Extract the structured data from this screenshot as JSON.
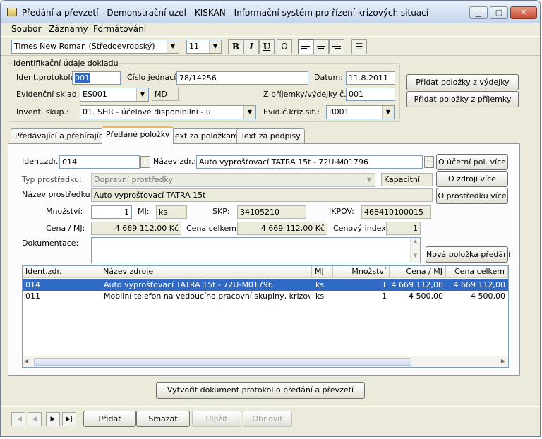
{
  "window": {
    "title": "Předání a převzetí - Demonstrační uzel - KISKAN - Informační systém pro řízení krizových situací",
    "min": "▁",
    "max": "▢",
    "close": "✕"
  },
  "menu": [
    "Soubor",
    "Záznamy",
    "Formátování"
  ],
  "toolbar": {
    "font": "Times New Roman (Středoevropský)",
    "size": "11",
    "bold": "B",
    "italic": "I",
    "underline": "U",
    "special": "Ω",
    "list": "☰"
  },
  "header": {
    "group_title": "Identifikační údaje dokladu",
    "ident_label": "Ident.protokolu:",
    "ident_value": "001",
    "cislo_label": "Číslo jednací:",
    "cislo_value": "78/14256",
    "datum_label": "Datum:",
    "datum_value": "11.8.2011",
    "sklad_label": "Evidenční sklad:",
    "sklad_value": "ES001",
    "sklad_extra": "MD",
    "zprijemky_label": "Z příjemky/výdejky č.:",
    "zprijemky_value": "001",
    "invent_label": "Invent. skup.:",
    "invent_value": "01. SHR - účelové disponibilní - u",
    "evid_label": "Evid.č.kriz.sit.:",
    "evid_value": "R001",
    "btn_vydejky": "Přidat položky z výdejky",
    "btn_prijemky": "Přidat položky z příjemky"
  },
  "tabs": [
    "Předávající a přebírající",
    "Předané položky",
    "Text za položkami",
    "Text za podpisy"
  ],
  "form": {
    "identzdr_label": "Ident.zdr.:",
    "identzdr_value": "014",
    "nazevzdr_label": "Název zdr.:",
    "nazevzdr_value": "Auto vyprošťovací TATRA 15t - 72U-M01796",
    "ellipsis": "...",
    "btn_ucetni": "O účetní pol. více",
    "typ_label": "Typ prostředku:",
    "typ_value": "Dopravní prostředky",
    "kapacitni": "Kapacitní",
    "btn_zdroj": "O zdroji více",
    "nazevprost_label": "Název prostředku:",
    "nazevprost_value": "Auto vyprošťovací TATRA 15t",
    "btn_prostredek": "O prostředku více",
    "mnozstvi_label": "Množství:",
    "mnozstvi_value": "1",
    "mj_label": "MJ:",
    "mj_value": "ks",
    "skp_label": "SKP:",
    "skp_value": "34105210",
    "jkpov_label": "JKPOV:",
    "jkpov_value": "468410100015",
    "cena_label": "Cena / MJ:",
    "cena_value": "4 669 112,00 Kč",
    "celkem_label": "Cena celkem:",
    "celkem_value": "4 669 112,00 Kč",
    "index_label": "Cenový index:",
    "index_value": "1",
    "dok_label": "Dokumentace:",
    "btn_nova": "Nová položka předání"
  },
  "grid": {
    "columns": [
      "Ident.zdr.",
      "Název zdroje",
      "MJ",
      "Množství",
      "Cena / MJ",
      "Cena celkem"
    ],
    "rows": [
      [
        "014",
        "Auto vyprošťovací TATRA 15t - 72U-M01796",
        "ks",
        "1",
        "4 669 112,00",
        "4 669 112,00"
      ],
      [
        "011",
        "Mobilní telefon na vedoucího pracovní skupiny, krizový štáb",
        "ks",
        "1",
        "4 500,00",
        "4 500,00"
      ]
    ]
  },
  "btn_vytvorit": "Vytvořit dokument protokol o předání a převzetí",
  "nav": {
    "first": "|◀",
    "prev": "◀",
    "next": "▶",
    "last": "▶|",
    "pridat": "Přidat",
    "smazat": "Smazat",
    "ulozit": "Uložit",
    "obnovit": "Obnovit"
  },
  "colors": {
    "selection": "#316ac5",
    "tab_highlight": "#f3b94d",
    "window_bg": "#eceadb"
  }
}
